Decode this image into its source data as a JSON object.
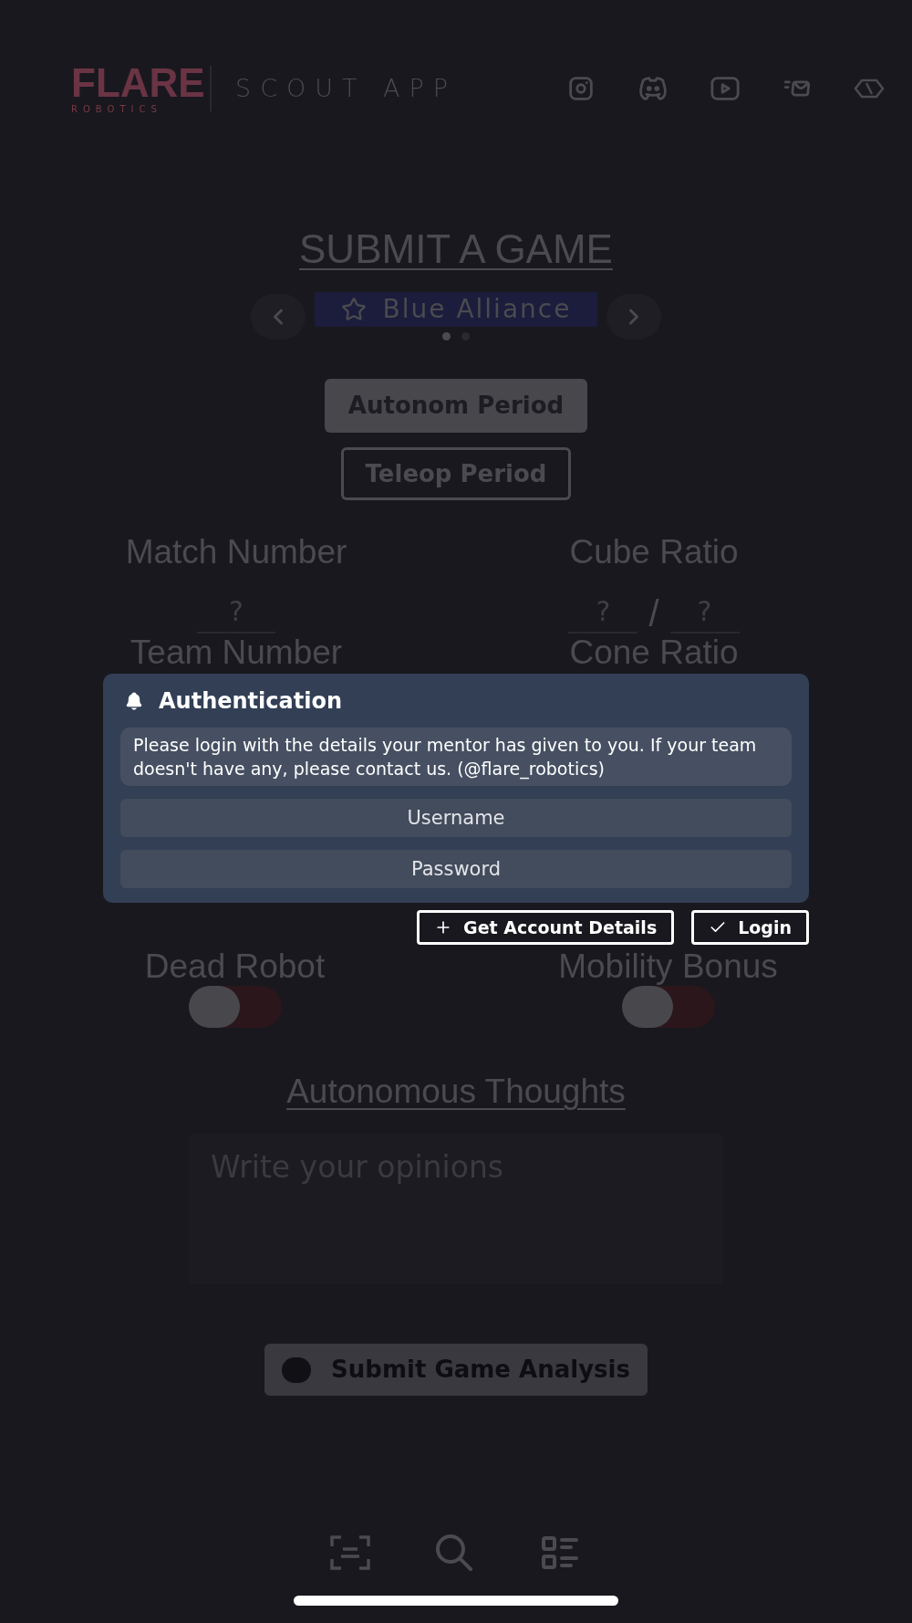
{
  "header": {
    "logo": {
      "text": "FLARE",
      "subtext": "ROBOTICS"
    },
    "title": "SCOUT APP"
  },
  "page_title": "SUBMIT A GAME",
  "alliance_carousel": {
    "label": "Blue Alliance",
    "dots": [
      {
        "selected": true
      },
      {
        "selected": false
      }
    ]
  },
  "period_tabs": [
    {
      "label": "Autonom Period",
      "selected": true
    },
    {
      "label": "Teleop Period",
      "selected": false
    }
  ],
  "fields": [
    {
      "label": "Match Number",
      "kind": "single",
      "inputs": [
        {
          "placeholder": "?"
        }
      ]
    },
    {
      "label": "Cube Ratio",
      "kind": "ratio",
      "separator": "/",
      "inputs": [
        {
          "placeholder": "?"
        },
        {
          "placeholder": "?"
        }
      ]
    }
  ],
  "next_row_labels": [
    "Team Number",
    "Cone Ratio"
  ],
  "toggles": [
    {
      "label": "Dead Robot",
      "on": false
    },
    {
      "label": "Mobility Bonus",
      "on": false
    }
  ],
  "thoughts": {
    "title": "Autonomous Thoughts",
    "placeholder": "Write your opinions"
  },
  "submit_button": {
    "label": "Submit Game Analysis"
  },
  "dialog": {
    "title": "Authentication",
    "message": "Please login with the details your mentor has given to you. If your team doesn't have any, please contact us. (@flare_robotics)",
    "inputs": [
      {
        "placeholder": "Username"
      },
      {
        "placeholder": "Password"
      }
    ],
    "buttons": [
      {
        "label": "Get Account Details",
        "kind": "add"
      },
      {
        "label": "Login",
        "kind": "confirm"
      }
    ]
  }
}
